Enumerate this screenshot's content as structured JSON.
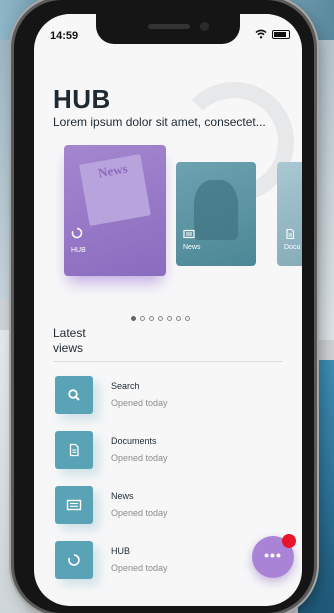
{
  "status": {
    "time": "14:59"
  },
  "header": {
    "title": "HUB",
    "subtitle": "Lorem ipsum dolor sit amet, consectet..."
  },
  "carousel": {
    "cards": [
      {
        "label": "HUB",
        "icon": "circle-refresh-icon",
        "color": "#9b7cd0",
        "image_text": "News"
      },
      {
        "label": "News",
        "icon": "newspaper-icon",
        "color": "#5d95a4"
      },
      {
        "label": "Docu",
        "icon": "document-icon",
        "color": "#9dbfca"
      }
    ],
    "pages": 7,
    "active_page": 1
  },
  "latest": {
    "heading": "Latest views",
    "items": [
      {
        "title": "Search",
        "meta": "Opened today",
        "icon": "search-icon"
      },
      {
        "title": "Documents",
        "meta": "Opened today",
        "icon": "document-icon"
      },
      {
        "title": "News",
        "meta": "Opened today",
        "icon": "newspaper-icon"
      },
      {
        "title": "HUB",
        "meta": "Opened today",
        "icon": "circle-refresh-icon"
      }
    ]
  },
  "fab": {
    "label": "•••",
    "accent": "#a984d6",
    "badge_color": "#e8142b"
  },
  "colors": {
    "tile": "#5aa2b6",
    "text": "#1e2a33",
    "muted": "#8c8c8c"
  }
}
